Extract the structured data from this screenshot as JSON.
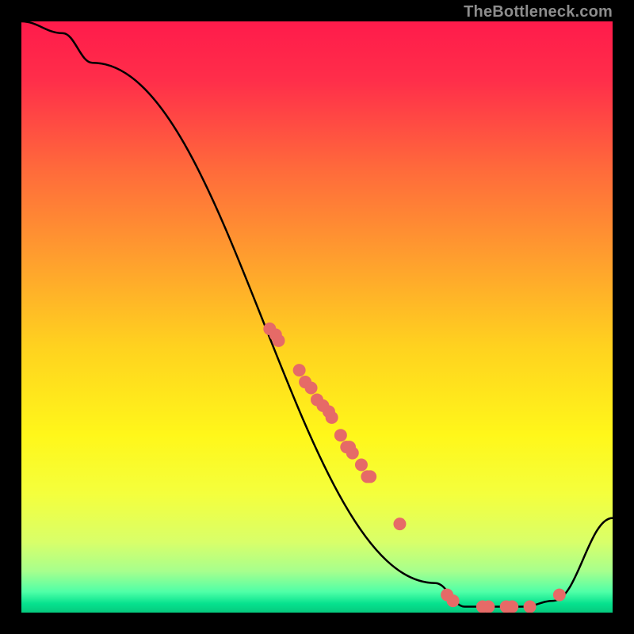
{
  "watermark": "TheBottleneck.com",
  "chart_data": {
    "type": "line",
    "title": "",
    "xlabel": "",
    "ylabel": "",
    "xlim": [
      0,
      100
    ],
    "ylim": [
      0,
      100
    ],
    "curve": [
      {
        "x": 0,
        "y": 100
      },
      {
        "x": 7,
        "y": 98
      },
      {
        "x": 12,
        "y": 93
      },
      {
        "x": 70,
        "y": 5
      },
      {
        "x": 75,
        "y": 1
      },
      {
        "x": 85,
        "y": 1
      },
      {
        "x": 90,
        "y": 2
      },
      {
        "x": 100,
        "y": 16
      }
    ],
    "markers": [
      {
        "x": 42.0,
        "y": 48
      },
      {
        "x": 43.0,
        "y": 47
      },
      {
        "x": 43.5,
        "y": 46
      },
      {
        "x": 47.0,
        "y": 41
      },
      {
        "x": 48.0,
        "y": 39
      },
      {
        "x": 49.0,
        "y": 38
      },
      {
        "x": 50.0,
        "y": 36
      },
      {
        "x": 51.0,
        "y": 35
      },
      {
        "x": 52.0,
        "y": 34
      },
      {
        "x": 52.5,
        "y": 33
      },
      {
        "x": 54.0,
        "y": 30
      },
      {
        "x": 55.0,
        "y": 28
      },
      {
        "x": 55.5,
        "y": 28
      },
      {
        "x": 56.0,
        "y": 27
      },
      {
        "x": 57.5,
        "y": 25
      },
      {
        "x": 58.5,
        "y": 23
      },
      {
        "x": 59.0,
        "y": 23
      },
      {
        "x": 64.0,
        "y": 15
      },
      {
        "x": 72.0,
        "y": 3
      },
      {
        "x": 73.0,
        "y": 2
      },
      {
        "x": 78.0,
        "y": 1
      },
      {
        "x": 79.0,
        "y": 1
      },
      {
        "x": 82.0,
        "y": 1
      },
      {
        "x": 83.0,
        "y": 1
      },
      {
        "x": 86.0,
        "y": 1
      },
      {
        "x": 91.0,
        "y": 3
      }
    ],
    "gradient_stops": [
      {
        "offset": 0.0,
        "color": "#ff1b4b"
      },
      {
        "offset": 0.1,
        "color": "#ff2e4a"
      },
      {
        "offset": 0.25,
        "color": "#ff6a3b"
      },
      {
        "offset": 0.4,
        "color": "#ff9e2e"
      },
      {
        "offset": 0.55,
        "color": "#ffd21f"
      },
      {
        "offset": 0.7,
        "color": "#fff71a"
      },
      {
        "offset": 0.8,
        "color": "#f4ff3d"
      },
      {
        "offset": 0.88,
        "color": "#d9ff69"
      },
      {
        "offset": 0.93,
        "color": "#a7ff8d"
      },
      {
        "offset": 0.965,
        "color": "#4fffa7"
      },
      {
        "offset": 0.985,
        "color": "#06e28e"
      },
      {
        "offset": 1.0,
        "color": "#06c97e"
      }
    ],
    "marker_style": {
      "fill": "#e66a67",
      "r": 8
    },
    "line_style": {
      "stroke": "#000000",
      "width": 2.5
    }
  }
}
